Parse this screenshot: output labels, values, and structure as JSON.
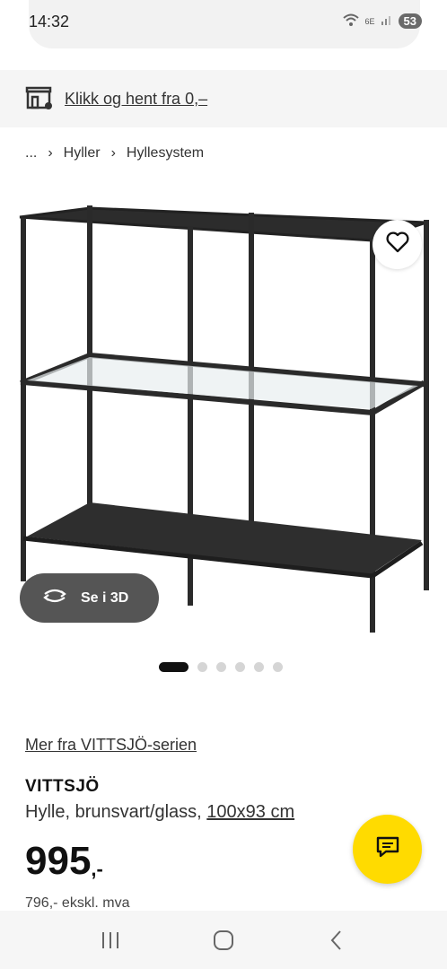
{
  "status_bar": {
    "time": "14:32",
    "network": "6E",
    "battery": "53"
  },
  "click_collect": {
    "label": "Klikk og hent fra 0,–"
  },
  "breadcrumb": {
    "items": [
      "...",
      "Hyller",
      "Hyllesystem"
    ]
  },
  "gallery": {
    "view_3d_label": "Se i 3D",
    "dot_count": 6,
    "active_dot": 0
  },
  "product": {
    "series_link": "Mer fra VITTSJÖ-serien",
    "name": "VITTSJÖ",
    "description": "Hylle, brunsvart/glass, ",
    "dimensions": "100x93 cm",
    "price_integer": "995",
    "price_decimal": ",-",
    "price_ex_vat": "796,- ekskl. mva"
  },
  "colors": {
    "accent_yellow": "#ffdb00",
    "dark_button": "#555555",
    "shelf_frame": "#2a2a2a"
  },
  "icons": {
    "store": "store-icon",
    "favourite": "heart-icon",
    "rotate_3d": "rotate-3d-icon",
    "chat": "chat-icon"
  }
}
